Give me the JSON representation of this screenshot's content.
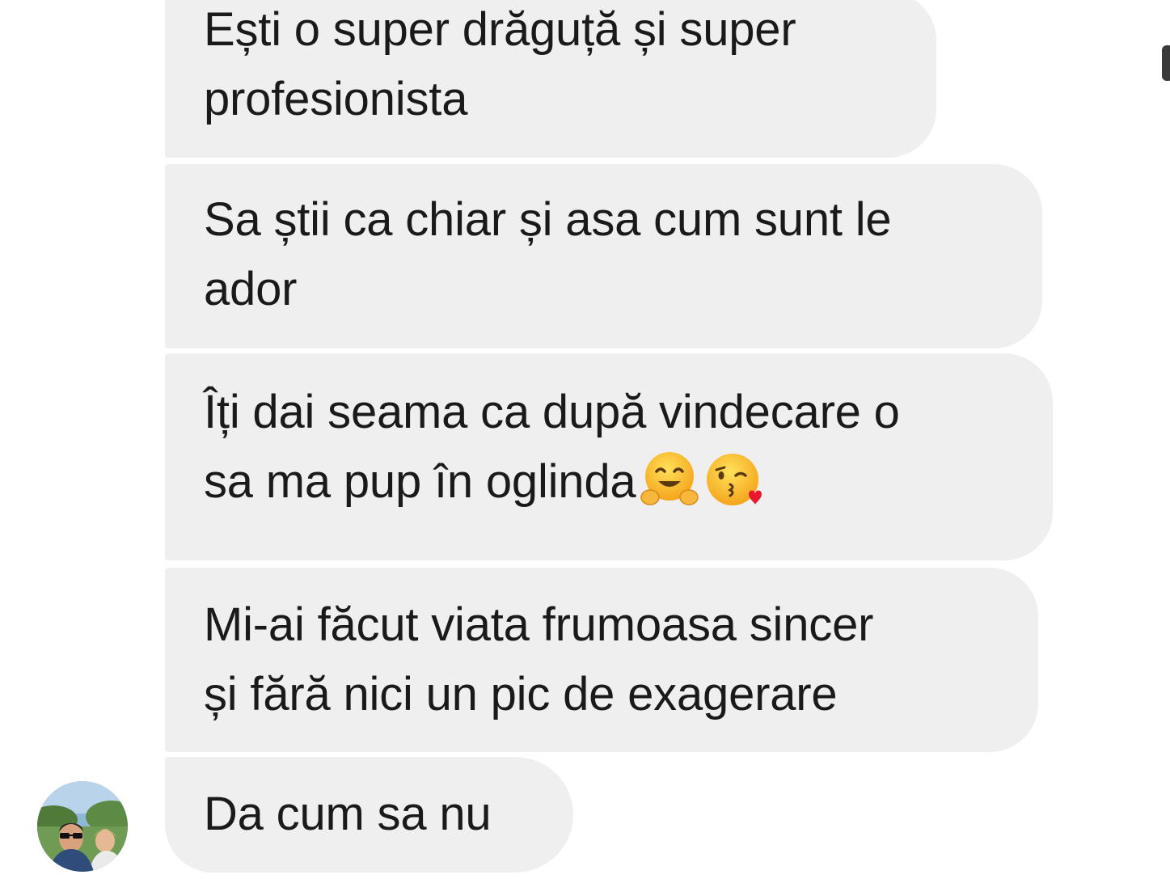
{
  "thread": {
    "messages": [
      {
        "lines": [
          "Ești o super drăguță și super",
          "profesionista"
        ]
      },
      {
        "lines": [
          "Sa știi ca chiar și asa cum sunt le",
          "ador"
        ]
      },
      {
        "lines": [
          "Îți dai seama ca după vindecare o",
          "sa ma pup în oglinda"
        ],
        "emojis": [
          "hugging-face-icon",
          "kissing-heart-face-icon"
        ]
      },
      {
        "lines": [
          "Mi-ai făcut viata frumoasa sincer",
          "și fără nici un pic de exagerare"
        ]
      },
      {
        "lines": [
          "Da cum sa nu"
        ]
      }
    ]
  },
  "colors": {
    "bubble_bg": "#efefef",
    "text": "#1a1a1a",
    "background": "#ffffff"
  }
}
